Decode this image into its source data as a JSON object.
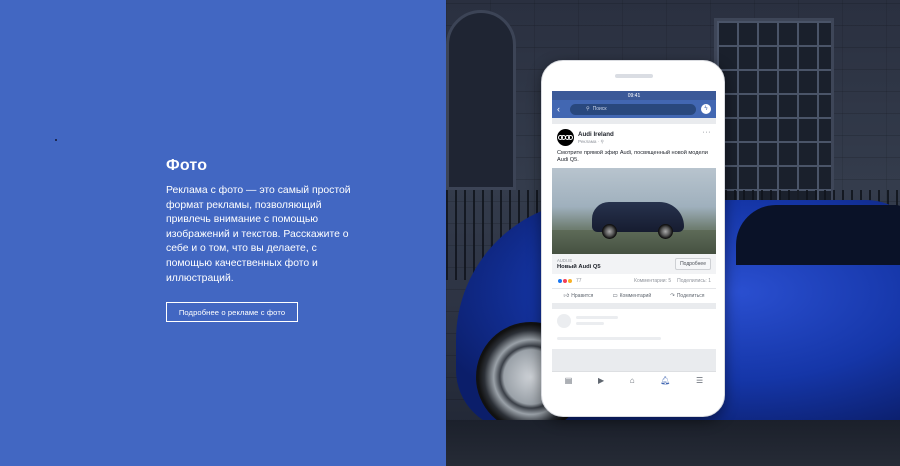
{
  "hero": {
    "title": "Фото",
    "description": "Реклама с фото — это самый простой формат рекламы, позволяющий привлечь внимание с помощью изображений и текстов. Расскажите о себе и о том, что вы делаете, с помощью качественных фото и иллюстраций.",
    "cta_label": "Подробнее о рекламе с фото"
  },
  "phone": {
    "status_time": "09:41",
    "search_placeholder": "Поиск",
    "post": {
      "page_name": "Audi Ireland",
      "sponsored": "Реклама · ⚲",
      "text": "Смотрите прямой эфир Audi, посвященный новой модели Audi Q5.",
      "ad_domain": "AUDI.IE",
      "ad_headline": "Новый Audi Q5",
      "ad_button": "Подробнее",
      "reaction_count": "77",
      "comments": "Комментарии: 5",
      "shares": "Поделились: 1",
      "actions": {
        "like": "Нравится",
        "comment": "Комментарий",
        "share": "Поделиться"
      }
    }
  },
  "colors": {
    "left_panel": "#4267c2",
    "facebook_blue": "#4267b2"
  }
}
